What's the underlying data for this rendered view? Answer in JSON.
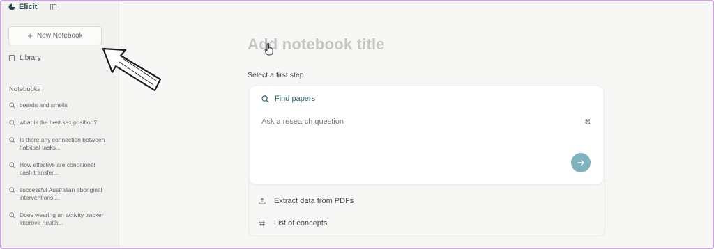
{
  "sidebar": {
    "brand": "Elicit",
    "new_notebook": "New Notebook",
    "library": "Library",
    "notebooks_heading": "Notebooks",
    "notebooks": [
      "beards and smells",
      "what is the best sex position?",
      "Is there any connection between habitual tasks...",
      "How effective are conditional cash transfer...",
      "successful Australian aboriginal interventions ...",
      "Does wearing an activity tracker improve health..."
    ]
  },
  "main": {
    "title_placeholder": "Add notebook title",
    "step_label": "Select a first step",
    "find_papers": "Find papers",
    "question_placeholder": "Ask a research question",
    "kbd_hint": "⌘",
    "options": [
      "Extract data from PDFs",
      "List of concepts"
    ]
  },
  "colors": {
    "brand": "#2b4a55",
    "accent": "#7fb3bf",
    "frame": "#c9a6d9"
  }
}
